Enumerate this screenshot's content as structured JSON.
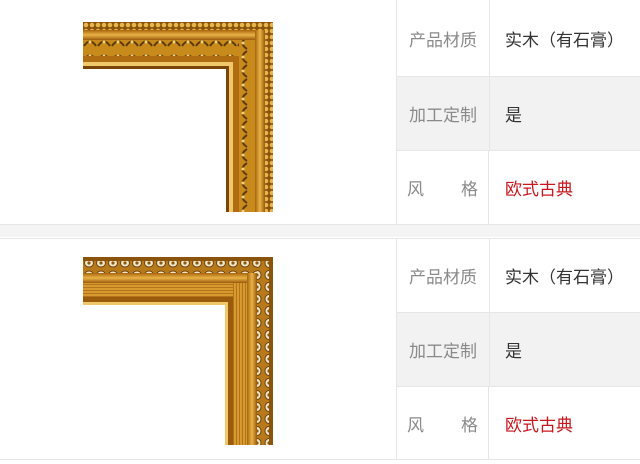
{
  "products": [
    {
      "image_icon": "ornate-gold-frame-corner-leaf",
      "specs": {
        "material_label": "产品材质",
        "material_value": "实木（有石膏）",
        "custom_label": "加工定制",
        "custom_value": "是",
        "style_label_1": "风",
        "style_label_2": "格",
        "style_value": "欧式古典"
      }
    },
    {
      "image_icon": "ornate-gold-frame-corner-pearl",
      "specs": {
        "material_label": "产品材质",
        "material_value": "实木（有石膏）",
        "custom_label": "加工定制",
        "custom_value": "是",
        "style_label_1": "风",
        "style_label_2": "格",
        "style_value": "欧式古典"
      }
    }
  ],
  "colors": {
    "accent_red": "#c8161d",
    "label_gray": "#8a8a8a",
    "gold": "#c98a1c"
  }
}
